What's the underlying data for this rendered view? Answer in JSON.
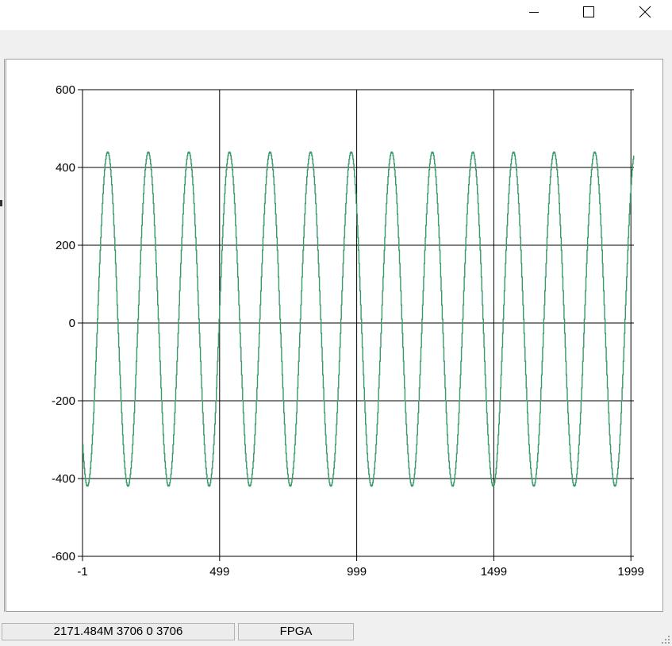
{
  "window": {
    "controls": [
      "minimize-icon",
      "maximize-icon",
      "close-icon"
    ]
  },
  "chart_data": {
    "type": "line",
    "title": "",
    "xlabel": "",
    "ylabel": "",
    "xlim": [
      -1,
      2010
    ],
    "ylim": [
      -600,
      600
    ],
    "x_ticks": [
      -1,
      499,
      999,
      1499,
      1999
    ],
    "x_tick_labels": [
      "-1",
      "499",
      "999",
      "1499",
      "1999"
    ],
    "y_ticks": [
      600,
      400,
      200,
      0,
      -200,
      -400,
      -600
    ],
    "y_tick_labels": [
      "600",
      "400",
      "200",
      "0",
      "-200",
      "-400",
      "-600"
    ],
    "grid": true,
    "series": [
      {
        "color": "#3a9a6a",
        "x_start": -1,
        "x_end": 2009,
        "amplitude_max": 440,
        "amplitude_min": -420,
        "period": 148,
        "x_at_first_peak": 90
      }
    ]
  },
  "status": {
    "panel1": "2171.484M 3706 0 3706",
    "panel2": "FPGA"
  },
  "colors": {
    "series": "#3a9a6a",
    "grid": "#000000",
    "background": "#ffffff"
  }
}
